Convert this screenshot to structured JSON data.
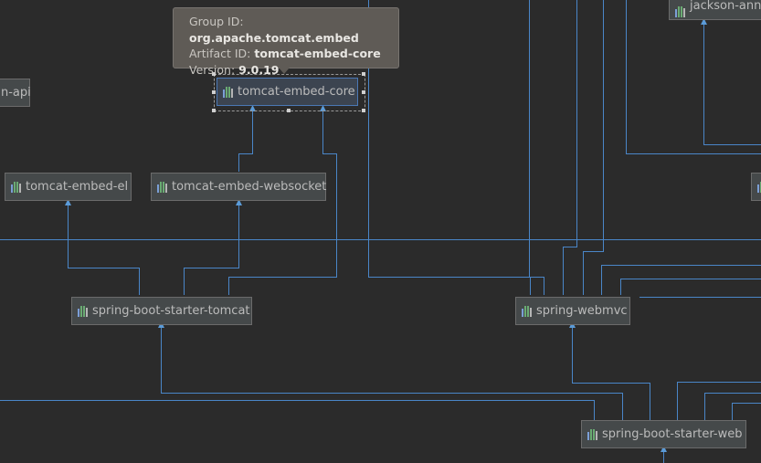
{
  "colors": {
    "background": "#2b2b2b",
    "edge": "#4a86c8",
    "node_fill": "#45494a",
    "node_border": "#6b6b6b",
    "selected_border": "#4a78b5",
    "tooltip_fill": "#5f5b56"
  },
  "tooltip": {
    "group_label": "Group ID:",
    "group_value": "org.apache.tomcat.embed",
    "artifact_label": "Artifact ID:",
    "artifact_value": "tomcat-embed-core",
    "version_label": "Version:",
    "version_value": "9.0.19"
  },
  "nodes": {
    "api_partial": "n-api",
    "tomcat_embed_core": "tomcat-embed-core",
    "tomcat_embed_el": "tomcat-embed-el",
    "tomcat_embed_websocket": "tomcat-embed-websocket",
    "spring_boot_starter_tomcat": "spring-boot-starter-tomcat",
    "spring_webmvc": "spring-webmvc",
    "spring_boot_starter_web": "spring-boot-starter-web",
    "jackson_partial": "jackson-anno"
  },
  "icon": "maven-artifact-icon"
}
